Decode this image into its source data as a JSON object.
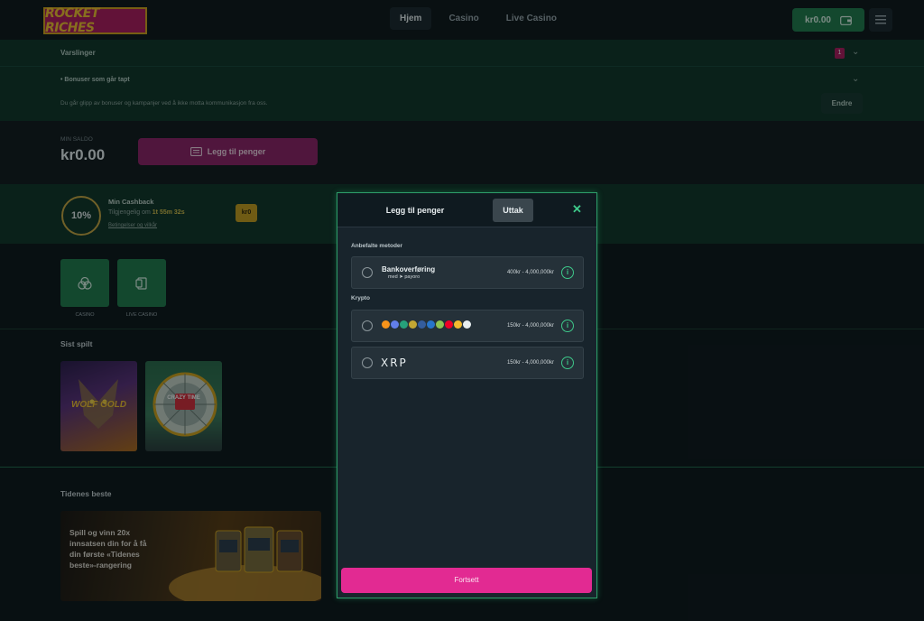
{
  "header": {
    "logo_text": "ROCKET RICHES",
    "nav": [
      {
        "label": "Hjem",
        "active": true
      },
      {
        "label": "Casino",
        "active": false
      },
      {
        "label": "Live Casino",
        "active": false
      }
    ],
    "wallet_amount": "kr0.00"
  },
  "notifications": {
    "title": "Varslinger",
    "badge_count": "1",
    "bonus_title": "Bonuser som går tapt",
    "bonus_desc": "Du går glipp av bonuser og kampanjer ved å ikke motta kommunikasjon fra oss.",
    "edit_label": "Endre"
  },
  "balance": {
    "label": "MIN SALDO",
    "value": "kr0.00",
    "add_money_label": "Legg til penger"
  },
  "cashback": {
    "percent": "10%",
    "title": "Min Cashback",
    "available_prefix": "Tilgjengelig om",
    "available_time": "1t 55m 32s",
    "terms_link": "Betingelser og vilkår",
    "chip": "kr0"
  },
  "categories": [
    {
      "label": "CASINO"
    },
    {
      "label": "LIVE CASINO"
    }
  ],
  "sections": {
    "recent_title": "Sist spilt",
    "best_title": "Tidenes beste",
    "banner_text": "Spill og vinn 20x innsatsen din for å få din første «Tidenes beste»-rangering"
  },
  "games": [
    {
      "name": "WOLF GOLD"
    },
    {
      "name": "CRAZY TIME"
    }
  ],
  "modal": {
    "tab_deposit": "Legg til penger",
    "tab_withdraw": "Uttak",
    "recommended_label": "Anbefalte metoder",
    "crypto_label": "Krypto",
    "methods": [
      {
        "name": "Bankoverføring",
        "sub": "med ➤ payoro",
        "range": "400kr - 4,000,000kr"
      },
      {
        "name": "",
        "sub": "",
        "range": "150kr - 4,000,000kr"
      },
      {
        "name": "XRP",
        "sub": "",
        "range": "150kr - 4,000,000kr"
      }
    ],
    "continue_label": "Fortsett"
  },
  "colors": {
    "accent_green": "#3ec98a",
    "accent_pink": "#e22a92",
    "dark_bg": "#0c1519"
  }
}
